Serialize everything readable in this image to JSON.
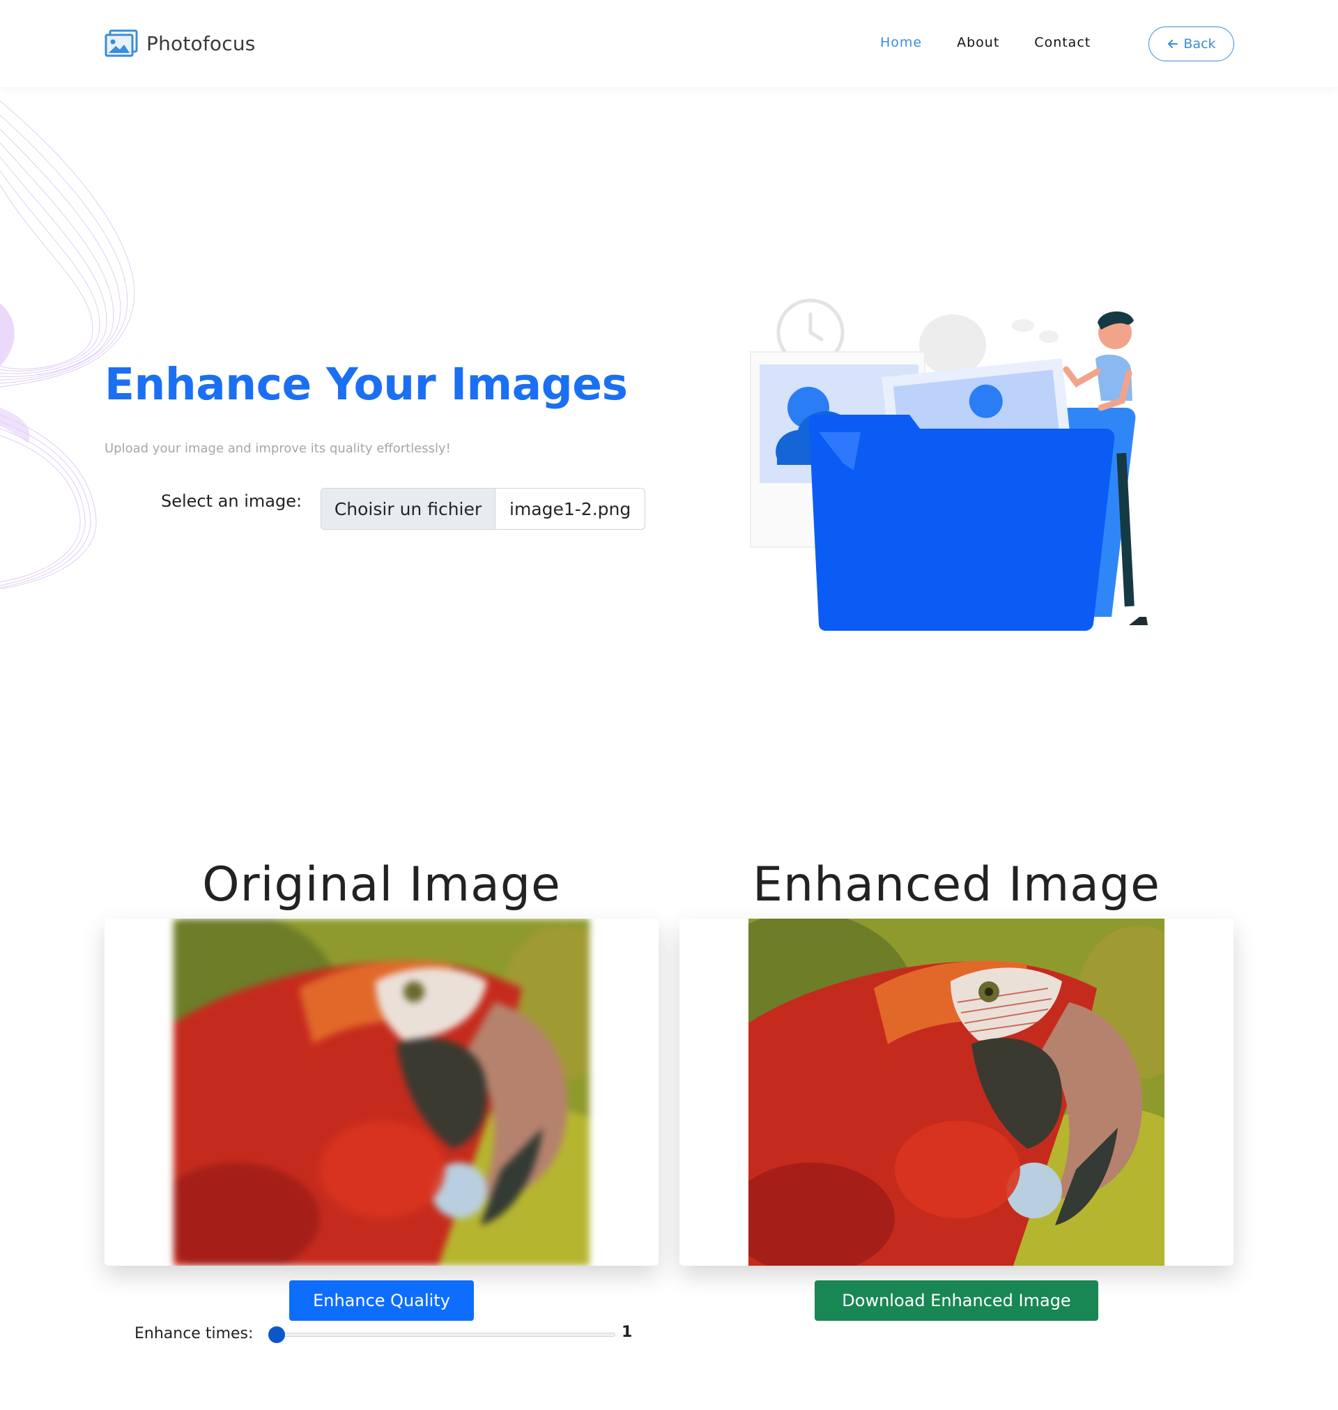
{
  "header": {
    "brand_name": "Photofocus",
    "nav": {
      "home": "Home",
      "about": "About",
      "contact": "Contact"
    },
    "back_label": "Back"
  },
  "hero": {
    "title": "Enhance Your Images",
    "subtitle": "Upload your image and improve its quality effortlessly!",
    "select_label": "Select an image:",
    "file_button_label": "Choisir un fichier",
    "file_name": "image1-2.png"
  },
  "comparison": {
    "original_title": "Original Image",
    "enhanced_title": "Enhanced Image",
    "enhance_button_label": "Enhance Quality",
    "download_button_label": "Download Enhanced Image",
    "enhance_times_label": "Enhance times:",
    "enhance_times_value": "1"
  },
  "colors": {
    "accent": "#1b6ff2",
    "nav_active": "#3a8ddb",
    "primary_button": "#0d6efd",
    "success_button": "#198754"
  },
  "icons": {
    "brand": "image-gallery-icon",
    "back": "arrow-left-icon"
  }
}
